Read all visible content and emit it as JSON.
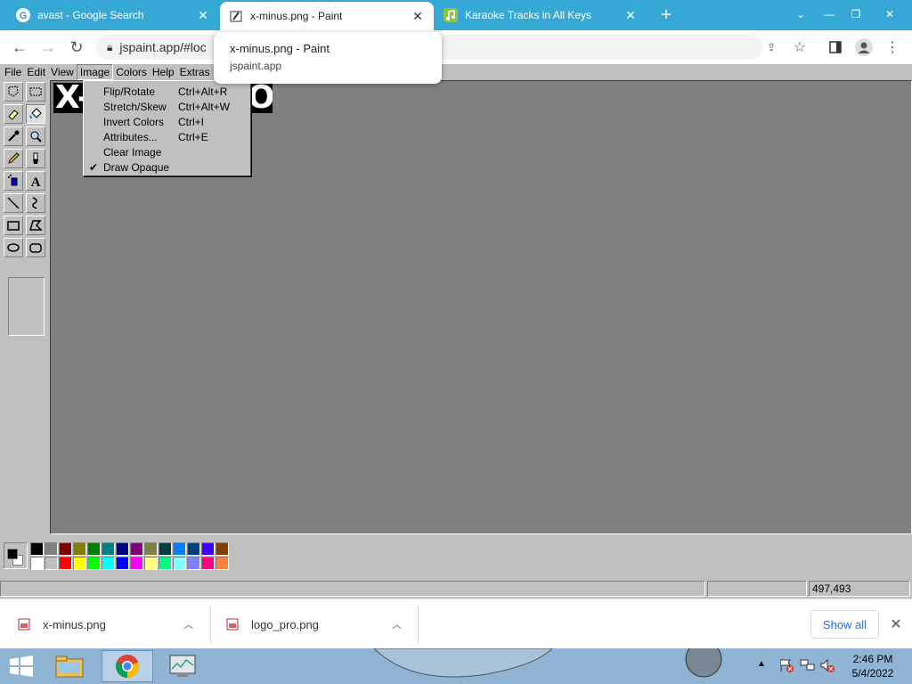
{
  "browser": {
    "tabs": [
      {
        "title": "avast - Google Search",
        "icon": "google-icon"
      },
      {
        "title": "x-minus.png - Paint",
        "icon": "paint-icon"
      },
      {
        "title": "Karaoke Tracks in All Keys",
        "icon": "music-note-icon"
      }
    ],
    "new_tab": "+",
    "address": "jspaint.app/#loc",
    "tooltip": {
      "title": "x-minus.png - Paint",
      "origin": "jspaint.app"
    },
    "colors": {
      "tabstrip": "#35a8d6",
      "link": "#1a73e8"
    }
  },
  "paint": {
    "menus": [
      "File",
      "Edit",
      "View",
      "Image",
      "Colors",
      "Help",
      "Extras"
    ],
    "open_menu": "Image",
    "image_menu": [
      {
        "label": "Flip/Rotate",
        "shortcut": "Ctrl+Alt+R",
        "checked": false
      },
      {
        "label": "Stretch/Skew",
        "shortcut": "Ctrl+Alt+W",
        "checked": false
      },
      {
        "label": "Invert Colors",
        "shortcut": "Ctrl+I",
        "checked": false
      },
      {
        "label": "Attributes...",
        "shortcut": "Ctrl+E",
        "checked": false
      },
      {
        "label": "Clear Image",
        "shortcut": "",
        "checked": false
      },
      {
        "label": "Draw Opaque",
        "shortcut": "",
        "checked": true
      }
    ],
    "check_mark": "✔",
    "tools": [
      "free-form-select-icon",
      "select-icon",
      "eraser-icon",
      "fill-icon",
      "pick-color-icon",
      "magnifier-icon",
      "pencil-icon",
      "brush-icon",
      "airbrush-icon",
      "text-icon",
      "line-icon",
      "curve-icon",
      "rectangle-icon",
      "polygon-icon",
      "ellipse-icon",
      "rounded-rectangle-icon"
    ],
    "canvas_text": "X-",
    "canvas_text_end": "O",
    "palette_top": [
      "#000000",
      "#808080",
      "#800000",
      "#808000",
      "#008000",
      "#008080",
      "#000080",
      "#800080",
      "#808040",
      "#004040",
      "#0080ff",
      "#004080",
      "#4000ff",
      "#804000"
    ],
    "palette_bottom": [
      "#ffffff",
      "#c0c0c0",
      "#ff0000",
      "#ffff00",
      "#00ff00",
      "#00ffff",
      "#0000ff",
      "#ff00ff",
      "#ffff80",
      "#00ff80",
      "#80ffff",
      "#8080ff",
      "#ff0080",
      "#ff8040"
    ],
    "primary_color": "#000000",
    "secondary_color": "#ffffff",
    "status": {
      "text": "",
      "size": "",
      "coords": "497,493"
    }
  },
  "downloads": {
    "items": [
      {
        "name": "x-minus.png"
      },
      {
        "name": "logo_pro.png"
      }
    ],
    "show_all": "Show all"
  },
  "taskbar": {
    "time": "2:46 PM",
    "date": "5/4/2022"
  }
}
